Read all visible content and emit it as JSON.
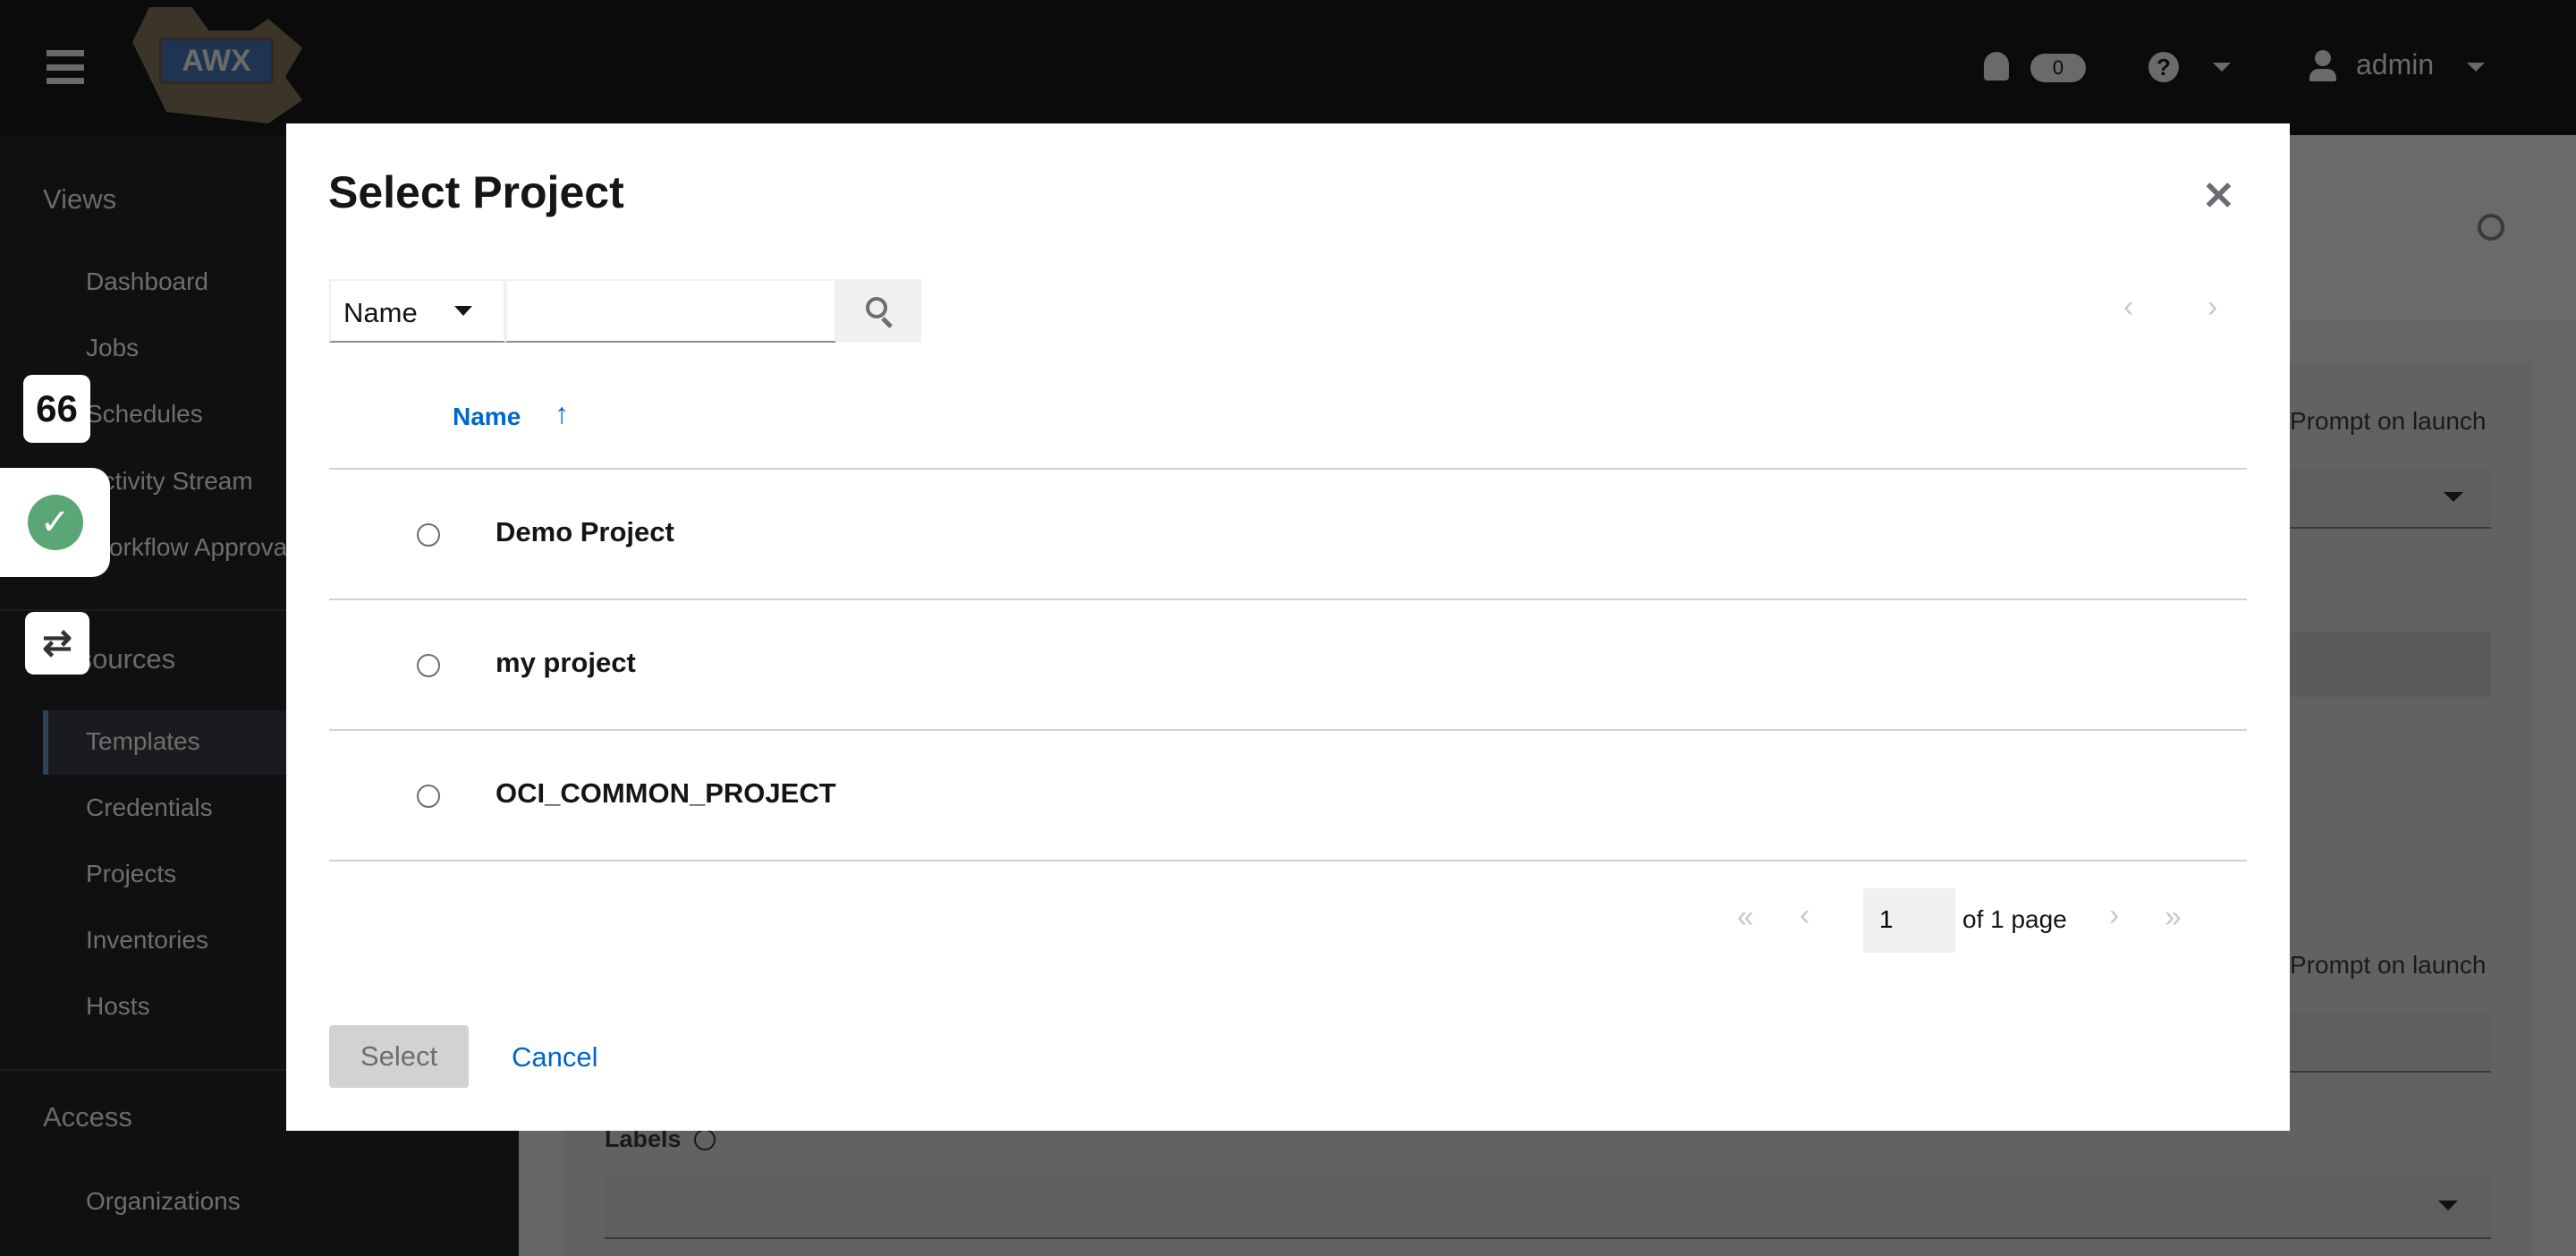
{
  "header": {
    "logo_text": "AWX",
    "notification_count": "0",
    "user": "admin"
  },
  "sidebar": {
    "sections": [
      {
        "label": "Views",
        "items": [
          "Dashboard",
          "Jobs",
          "Schedules",
          "Activity Stream",
          "Workflow Approvals"
        ]
      },
      {
        "label": "Resources",
        "items": [
          "Templates",
          "Credentials",
          "Projects",
          "Inventories",
          "Hosts"
        ]
      },
      {
        "label": "Access",
        "items": [
          "Organizations"
        ]
      }
    ],
    "active_item": "Templates"
  },
  "widgets": {
    "counter": "66"
  },
  "background": {
    "prompt_label_1": "Prompt on launch",
    "prompt_label_2": "Prompt on launch",
    "labels_label": "Labels"
  },
  "modal": {
    "title": "Select Project",
    "search": {
      "field": "Name",
      "value": "",
      "placeholder": ""
    },
    "column_header": "Name",
    "rows": [
      {
        "name": "Demo Project"
      },
      {
        "name": "my project"
      },
      {
        "name": "OCI_COMMON_PROJECT"
      }
    ],
    "pagination": {
      "page": "1",
      "of_text": "of 1 page"
    },
    "select_label": "Select",
    "cancel_label": "Cancel"
  },
  "colors": {
    "link": "#0066cc",
    "header_bg": "#0b0b0b",
    "success": "#5ba675"
  }
}
